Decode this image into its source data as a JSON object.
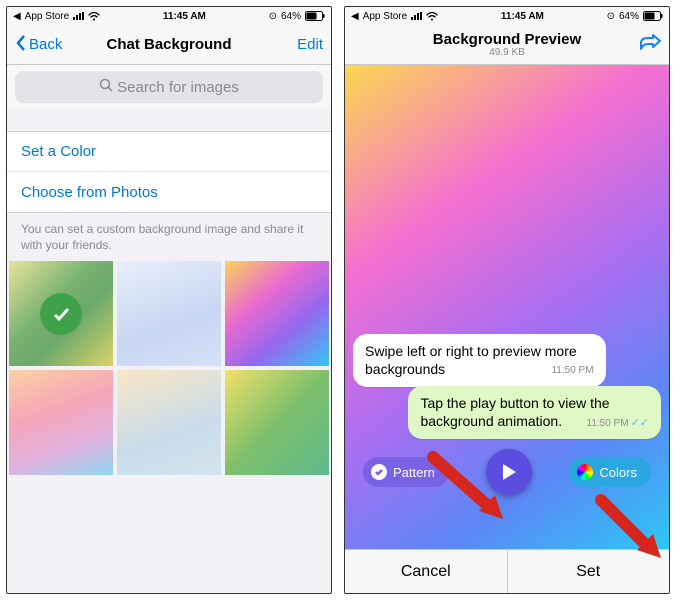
{
  "status": {
    "source": "App Store",
    "time": "11:45 AM",
    "battery_pct": "64%"
  },
  "left": {
    "nav": {
      "back": "Back",
      "title": "Chat Background",
      "edit": "Edit"
    },
    "search_placeholder": "Search for images",
    "cells": {
      "set_color": "Set a Color",
      "choose_photos": "Choose from Photos"
    },
    "helper": "You can set a custom background image and share it with your friends."
  },
  "right": {
    "nav": {
      "title": "Background Preview",
      "subtitle": "49.9 KB"
    },
    "bubble_in": {
      "text": "Swipe left or right to preview more backgrounds",
      "time": "11:50 PM"
    },
    "bubble_out": {
      "text": "Tap the play button to view the background animation.",
      "time": "11:50 PM"
    },
    "pattern_label": "Pattern",
    "colors_label": "Colors",
    "footer": {
      "cancel": "Cancel",
      "set": "Set"
    }
  }
}
